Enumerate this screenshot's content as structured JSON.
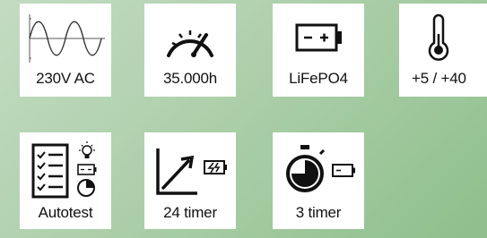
{
  "tiles": {
    "ac": {
      "label": "230V AC"
    },
    "hours": {
      "label": "35.000h"
    },
    "battery": {
      "label": "LiFePO4"
    },
    "temperature": {
      "label": "+5 / +40"
    },
    "autotest": {
      "label": "Autotest"
    },
    "charge": {
      "label": "24 timer"
    },
    "timer": {
      "label": "3 timer"
    }
  },
  "icons": {
    "ac": "sine-wave-icon",
    "hours": "speedometer-icon",
    "battery": "battery-icon",
    "temperature": "thermometer-icon",
    "autotest": [
      "checklist-icon",
      "lightbulb-icon",
      "battery-small-icon",
      "pie-clock-icon"
    ],
    "charge": [
      "growth-arrow-icon",
      "charging-battery-icon"
    ],
    "timer": [
      "stopwatch-icon",
      "battery-small-icon"
    ]
  },
  "colors": {
    "background": "#a8cda5",
    "tile": "#ffffff",
    "icon": "#111111"
  }
}
